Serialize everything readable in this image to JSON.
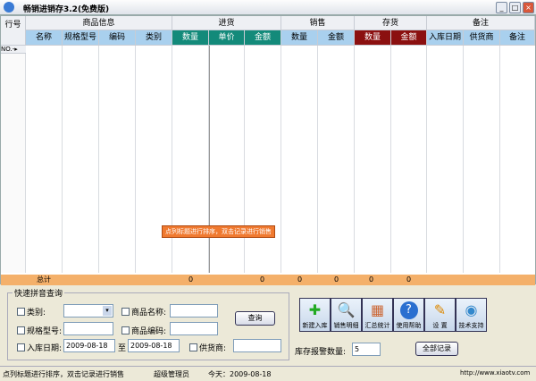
{
  "window": {
    "title": "畅销进销存3.2(免费版)"
  },
  "grid": {
    "row_header": "行号",
    "groups": [
      "商品信息",
      "进货",
      "销售",
      "存货",
      "备注"
    ],
    "columns": [
      "名称",
      "规格型号",
      "编码",
      "类别",
      "数量",
      "单价",
      "金额",
      "数量",
      "金额",
      "数量",
      "金额",
      "入库日期",
      "供货商",
      "备注"
    ],
    "row_indicator": "NO.-▸",
    "totals_label": "总计",
    "totals": [
      "0",
      "0",
      "0",
      "0",
      "0",
      "0"
    ],
    "colors": {
      "purchase": "#138a7a",
      "stock": "#8b1010",
      "header": "#a9d0ee",
      "totals": "#f4b06a"
    }
  },
  "tooltip": "点列标题进行排序，双击记录进行销售",
  "search": {
    "legend": "快速拼音查询",
    "category_label": "类别:",
    "category_value": "",
    "name_label": "商品名称:",
    "model_label": "规格型号:",
    "code_label": "商品编码:",
    "date_label": "入库日期:",
    "date_from": "2009-08-18",
    "date_to_label": "至",
    "date_to": "2009-08-18",
    "supplier_label": "供货商:",
    "query_button": "查询"
  },
  "toolbar": [
    {
      "label": "新建入库",
      "icon": "plus-icon"
    },
    {
      "label": "销售明细",
      "icon": "magnifier-icon"
    },
    {
      "label": "汇总统计",
      "icon": "calendar-icon"
    },
    {
      "label": "使用帮助",
      "icon": "help-icon"
    },
    {
      "label": "设 置",
      "icon": "wrench-icon"
    },
    {
      "label": "技术支持",
      "icon": "globe-icon"
    }
  ],
  "alert": {
    "label": "库存报警数量:",
    "value": "5"
  },
  "all_records_button": "全部记录",
  "status": {
    "hint": "点列标题进行排序，双击记录进行销售",
    "user": "超级管理员",
    "today": "今天：2009-08-18",
    "url": "http://www.xiaotv.com"
  }
}
